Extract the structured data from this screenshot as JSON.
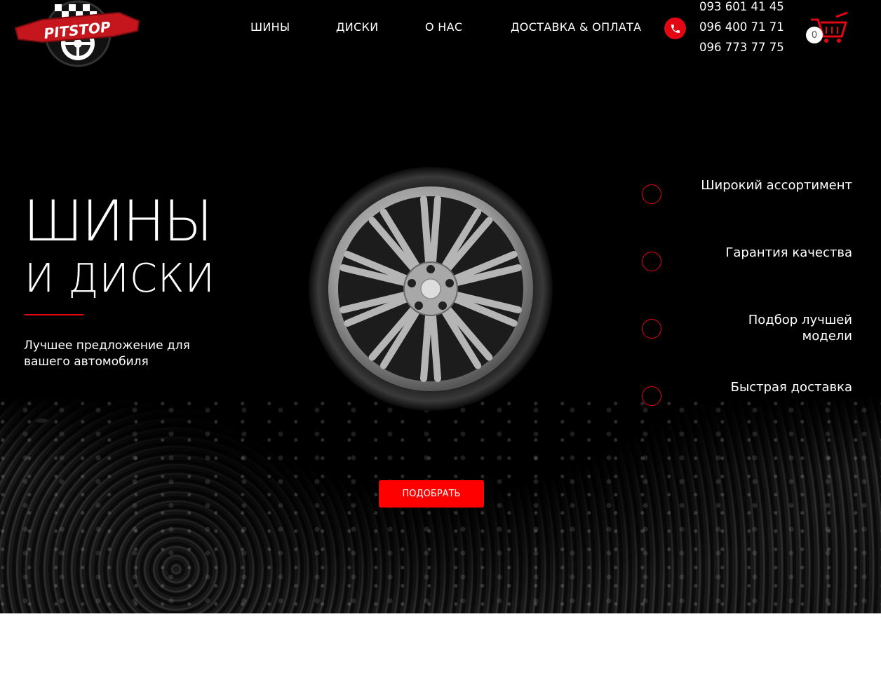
{
  "brand": {
    "logo_text": "PITSTOP"
  },
  "nav": {
    "items": [
      {
        "label": "ШИНЫ"
      },
      {
        "label": "ДИСКИ"
      },
      {
        "label": "О НАС"
      },
      {
        "label": "ДОСТАВКА & ОПЛАТА"
      }
    ]
  },
  "contacts": {
    "phones": [
      "093 601 41 45",
      "096 400 71 71",
      "096 773 77 75"
    ],
    "icon": "phone-icon"
  },
  "cart": {
    "count": "0",
    "icon": "cart-icon"
  },
  "hero": {
    "title_line1": "ШИНЫ",
    "title_line2": "И ДИСКИ",
    "subtitle": "Лучшее предложение для вашего автомобиля",
    "cta_label": "ПОДОБРАТЬ"
  },
  "features": [
    {
      "label": "Широкий ассортимент"
    },
    {
      "label": "Гарантия качества"
    },
    {
      "label": "Подбор лучшей модели"
    },
    {
      "label": "Быстрая доставка"
    }
  ],
  "colors": {
    "accent": "#e30613",
    "button": "#ff0000",
    "background": "#000000"
  }
}
